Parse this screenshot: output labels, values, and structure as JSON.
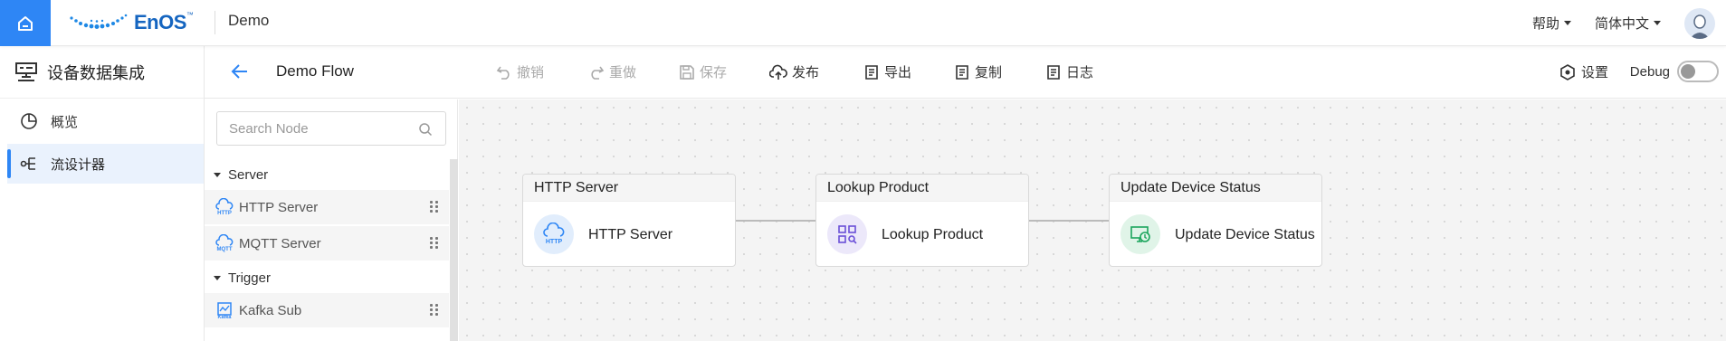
{
  "topbar": {
    "logo_text": "EnOS",
    "logo_tm": "™",
    "app_title": "Demo",
    "help_label": "帮助",
    "language_label": "简体中文"
  },
  "leftnav": {
    "header_label": "设备数据集成",
    "items": [
      {
        "label": "概览",
        "icon": "pie-chart-icon",
        "active": false
      },
      {
        "label": "流设计器",
        "icon": "flow-icon",
        "active": true
      }
    ]
  },
  "toolbar": {
    "flow_name": "Demo Flow",
    "undo_label": "撤销",
    "redo_label": "重做",
    "save_label": "保存",
    "publish_label": "发布",
    "export_label": "导出",
    "copy_label": "复制",
    "log_label": "日志",
    "settings_label": "设置",
    "debug_label": "Debug",
    "debug_enabled": false
  },
  "nodepanel": {
    "search_placeholder": "Search Node",
    "groups": [
      {
        "name": "Server",
        "items": [
          {
            "label": "HTTP Server",
            "icon": "http-cloud-icon"
          },
          {
            "label": "MQTT Server",
            "icon": "mqtt-cloud-icon"
          }
        ]
      },
      {
        "name": "Trigger",
        "items": [
          {
            "label": "Kafka Sub",
            "icon": "kafka-icon"
          }
        ]
      }
    ]
  },
  "canvas": {
    "nodes": [
      {
        "title": "HTTP Server",
        "label": "HTTP Server",
        "icon": "http-cloud-icon",
        "color": "#2e86f5"
      },
      {
        "title": "Lookup Product",
        "label": "Lookup Product",
        "icon": "lookup-grid-icon",
        "color": "#6a4fd8"
      },
      {
        "title": "Update Device Status",
        "label": "Update Device Status",
        "icon": "device-status-icon",
        "color": "#1aa55c"
      }
    ]
  },
  "colors": {
    "accent": "#2e86f5",
    "canvas_bg": "#f4f4f4"
  }
}
